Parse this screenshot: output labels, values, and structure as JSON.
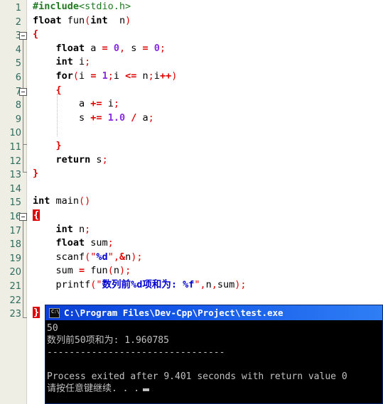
{
  "window": {
    "app": "Dev-C++ code editor with console output"
  },
  "editor": {
    "line_numbers": [
      "1",
      "2",
      "3",
      "4",
      "5",
      "6",
      "7",
      "8",
      "9",
      "10",
      "11",
      "12",
      "13",
      "14",
      "15",
      "16",
      "17",
      "18",
      "19",
      "20",
      "21",
      "22",
      "23"
    ],
    "lines": [
      {
        "n": "1",
        "text": "#include<stdio.h>"
      },
      {
        "n": "2",
        "text": "float fun(int  n)"
      },
      {
        "n": "3",
        "text": "{"
      },
      {
        "n": "4",
        "text": "    float a = 0, s = 0;"
      },
      {
        "n": "5",
        "text": "    int i;"
      },
      {
        "n": "6",
        "text": "    for(i = 1;i <= n;i++)"
      },
      {
        "n": "7",
        "text": "    {"
      },
      {
        "n": "8",
        "text": "        a += i;"
      },
      {
        "n": "9",
        "text": "        s += 1.0 / a;"
      },
      {
        "n": "10",
        "text": ""
      },
      {
        "n": "11",
        "text": "    }"
      },
      {
        "n": "12",
        "text": "    return s;"
      },
      {
        "n": "13",
        "text": "}"
      },
      {
        "n": "14",
        "text": ""
      },
      {
        "n": "15",
        "text": "int main()"
      },
      {
        "n": "16",
        "text": "{"
      },
      {
        "n": "17",
        "text": "    int n;"
      },
      {
        "n": "18",
        "text": "    float sum;"
      },
      {
        "n": "19",
        "text": "    scanf(\"%d\",&n);"
      },
      {
        "n": "20",
        "text": "    sum = fun(n);"
      },
      {
        "n": "21",
        "text": "    printf(\"数列前%d项和为: %f\",n,sum);"
      },
      {
        "n": "22",
        "text": ""
      },
      {
        "n": "23",
        "text": "}"
      }
    ],
    "tokens": {
      "l1_include": "#include",
      "l1_header": "<stdio.h>",
      "l2_float": "float",
      "l2_fun": " fun",
      "l2_open": "(",
      "l2_int": "int",
      "l2_n": "  n",
      "l2_close": ")",
      "l3_brace": "{",
      "l4_indent": "    ",
      "l4_float": "float",
      "l4_a": " a ",
      "l4_eq1": "=",
      "l4_zero1": " 0",
      "l4_comma": ",",
      "l4_s": " s ",
      "l4_eq2": "=",
      "l4_zero2": " 0",
      "l4_semi": ";",
      "l5_int": "int",
      "l5_i": " i",
      "l5_semi": ";",
      "l6_for": "for",
      "l6_p1": "(",
      "l6_i": "i ",
      "l6_eq": "=",
      "l6_one": " 1",
      "l6_s1": ";",
      "l6_i2": "i ",
      "l6_le": "<=",
      "l6_n": " n",
      "l6_s2": ";",
      "l6_i3": "i",
      "l6_inc": "++",
      "l6_p2": ")",
      "l7_brace": "{",
      "l8_a": "a ",
      "l8_pe": "+=",
      "l8_i": " i",
      "l8_semi": ";",
      "l9_s": "s ",
      "l9_pe": "+=",
      "l9_num": " 1.0 ",
      "l9_div": "/",
      "l9_a": " a",
      "l9_semi": ";",
      "l11_brace": "}",
      "l12_return": "return",
      "l12_s": " s",
      "l12_semi": ";",
      "l13_brace": "}",
      "l15_int": "int",
      "l15_main": " main",
      "l15_parens": "()",
      "l16_brace": "{",
      "l17_int": "int",
      "l17_n": " n",
      "l17_semi": ";",
      "l18_float": "float",
      "l18_sum": " sum",
      "l18_semi": ";",
      "l19_scanf": "scanf",
      "l19_p1": "(\"",
      "l19_fmt": "%d",
      "l19_p2": "\",",
      "l19_amp": "&",
      "l19_n": "n",
      "l19_p3": ");",
      "l20_sum": "sum ",
      "l20_eq": "=",
      "l20_fun": " fun",
      "l20_p1": "(",
      "l20_n": "n",
      "l20_p2": ")",
      "l20_semi": ";",
      "l21_printf": "printf",
      "l21_p1": "(\"",
      "l21_str1": "数列前",
      "l21_fmt1": "%d",
      "l21_str2": "项和为: ",
      "l21_fmt2": "%f",
      "l21_p2": "\",",
      "l21_n": "n",
      "l21_c": ",",
      "l21_sum": "sum",
      "l21_p3": ");",
      "l23_brace": "}"
    }
  },
  "console": {
    "title": "C:\\Program Files\\Dev-Cpp\\Project\\test.exe",
    "icon_label": "C:\\",
    "output": [
      "50",
      "数列前50项和为: 1.960785",
      "--------------------------------",
      "",
      "Process exited after 9.401 seconds with return value 0",
      "请按任意键继续. . ."
    ],
    "input_value": "50",
    "result_text": "数列前50项和为: 1.960785",
    "separator": "--------------------------------",
    "exit_message": "Process exited after 9.401 seconds with return value 0",
    "press_key_message": "请按任意键继续. . .",
    "exit_seconds": "9.401",
    "return_value": "0"
  },
  "colors": {
    "gutter_bg": "#eeeee4",
    "line_number": "#2f6b5f",
    "keyword": "#000000",
    "operator": "#e00000",
    "number": "#8a2be2",
    "string": "#0000d0",
    "preprocessor": "#1f7a1f",
    "brace_highlight_bg": "#e00000",
    "console_bg": "#000000",
    "console_text": "#c0c0c0",
    "titlebar_blue": "#0a3fd6"
  }
}
